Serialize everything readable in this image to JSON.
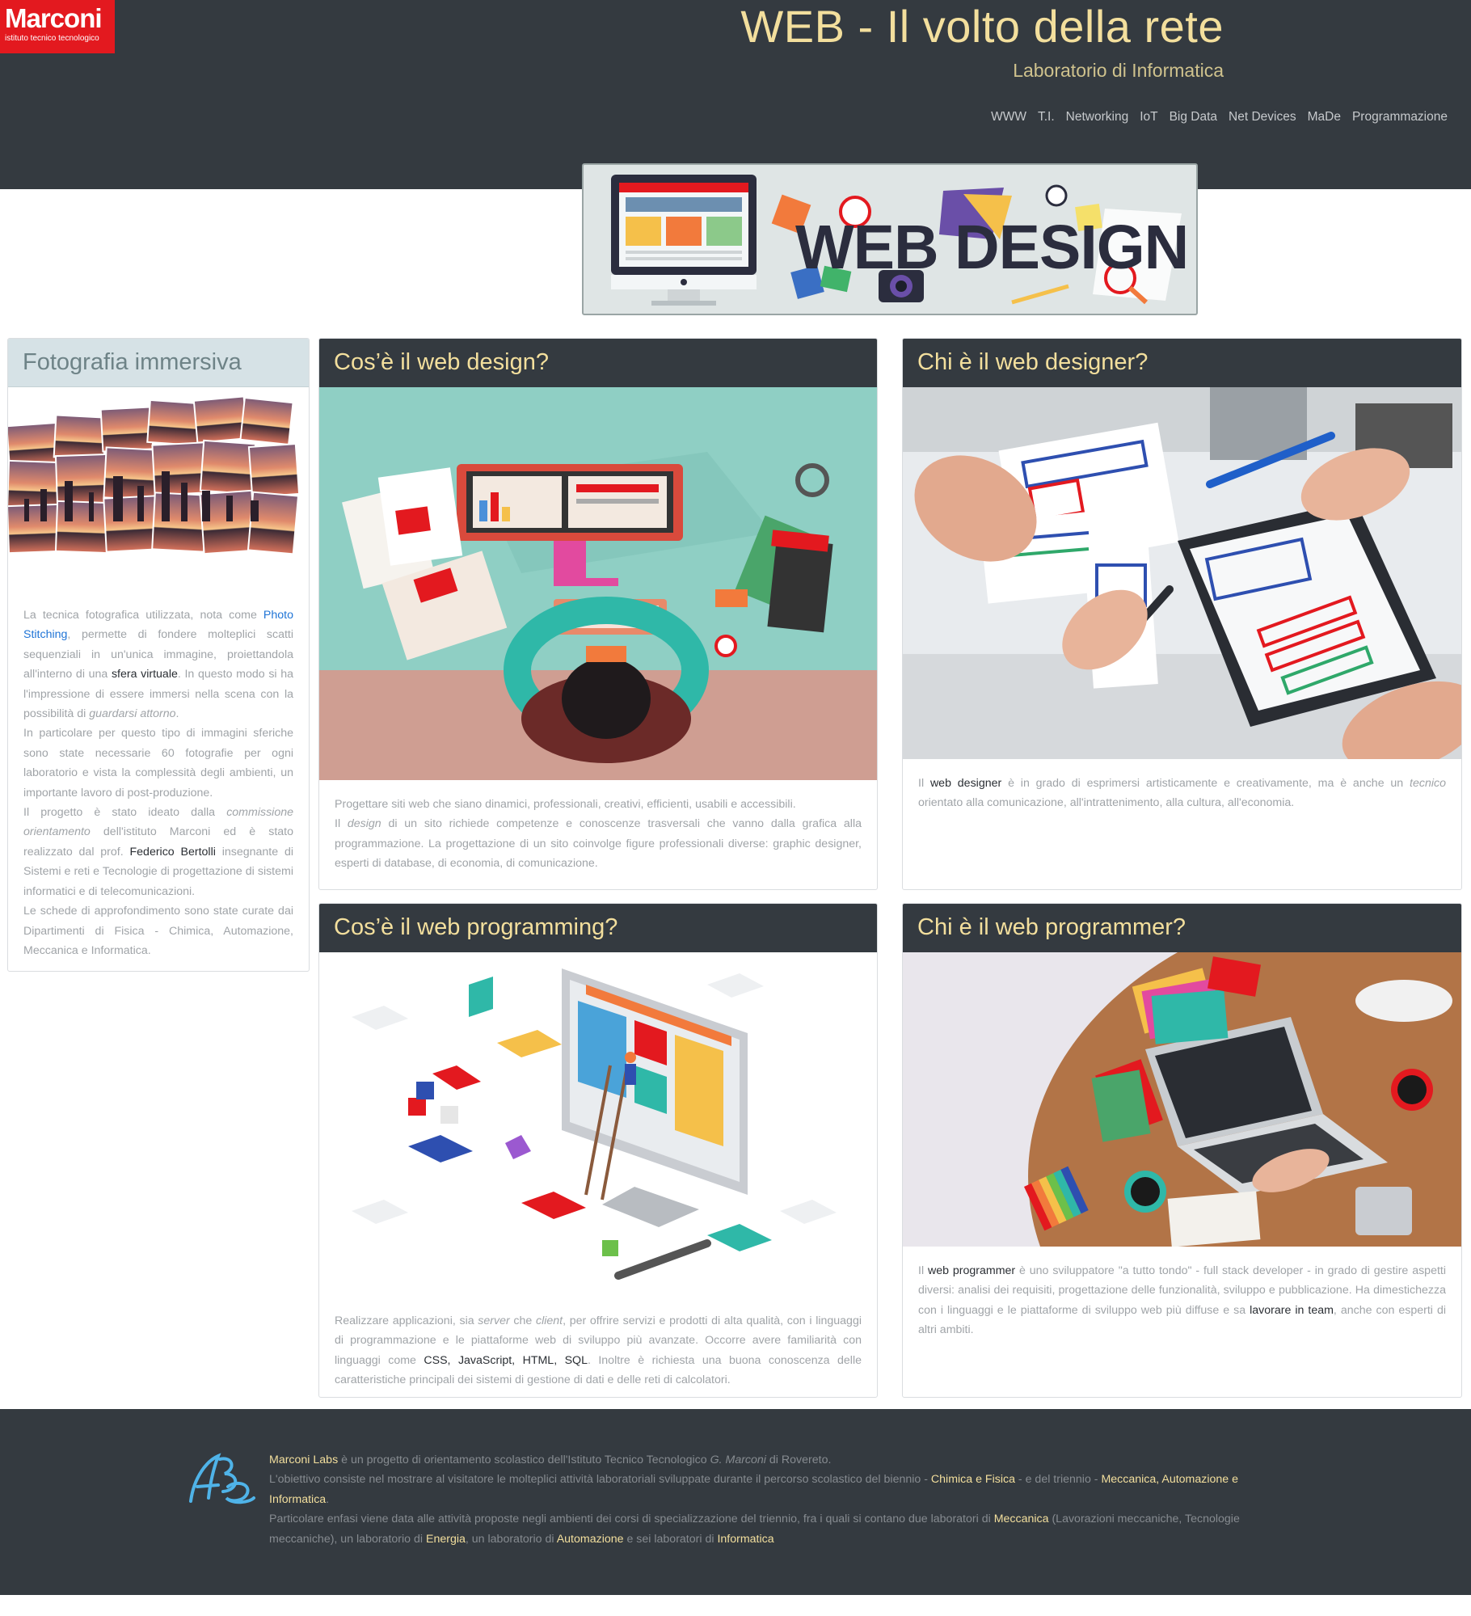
{
  "header": {
    "logo_name": "Marconi",
    "logo_subtitle": "istituto tecnico tecnologico",
    "title": "WEB - Il volto della rete",
    "subtitle": "Laboratorio di Informatica",
    "nav": [
      "WWW",
      "T.I.",
      "Networking",
      "IoT",
      "Big Data",
      "Net Devices",
      "MaDe",
      "Programmazione"
    ]
  },
  "banner": {
    "text": "WEB DESIGN"
  },
  "photo_card": {
    "title": "Fotografia immersiva",
    "p1": [
      "La tecnica fotografica utilizzata, nota come ",
      "Photo Stitching",
      ", permette di fondere molteplici scatti sequenziali in un'unica immagine, proiettandola all'interno di una ",
      "sfera virtuale",
      ". In questo modo si ha l'impressione di essere immersi nella scena con la possibilità di ",
      "guardarsi attorno",
      "."
    ],
    "p2": "In particolare per questo tipo di immagini sferiche sono state necessarie 60 fotografie per ogni laboratorio e vista la complessità degli ambienti, un importante lavoro di post-produzione.",
    "p3": [
      "Il progetto è stato ideato dalla ",
      "commissione orientamento",
      " dell'istituto Marconi ed è stato realizzato dal prof. ",
      "Federico Bertolli",
      " insegnante di Sistemi e reti e Tecnologie di progettazione di sistemi informatici e di telecomunicazioni."
    ],
    "p4": "Le schede di approfondimento sono state curate dai Dipartimenti di Fisica - Chimica, Automazione, Meccanica e Informatica."
  },
  "card_web_design": {
    "title": "Cos’è il web design?",
    "p1": "Progettare siti web che siano dinamici, professionali, creativi, efficienti, usabili e accessibili.",
    "p2": [
      "Il ",
      "design",
      " di un sito richiede competenze e conoscenze trasversali che vanno dalla grafica alla programmazione. La progettazione di un sito coinvolge figure professionali diverse: graphic designer, esperti di database, di economia, di comunicazione."
    ]
  },
  "card_web_designer": {
    "title": "Chi è il web designer?",
    "p1": [
      "Il ",
      "web designer",
      " è in grado di esprimersi artisticamente e creativamente, ma è anche un ",
      "tecnico",
      " orientato alla comunicazione, all'intrattenimento, alla cultura, all'economia."
    ]
  },
  "card_web_programming": {
    "title": "Cos’è il web programming?",
    "p1": [
      "Realizzare applicazioni, sia ",
      "server",
      " che ",
      "client",
      ", per offrire servizi e prodotti di alta qualità, con i linguaggi di programmazione e le piattaforme web di sviluppo più avanzate. Occorre avere familiarità con linguaggi come ",
      "CSS, JavaScript, HTML, SQL",
      ". Inoltre è richiesta una buona conoscenza delle caratteristiche principali dei sistemi di gestione di dati e delle reti di calcolatori."
    ]
  },
  "card_web_programmer": {
    "title": "Chi è il web programmer?",
    "p1": [
      "Il ",
      "web programmer",
      " è uno sviluppatore \"a tutto tondo\" - full stack developer - in grado di gestire aspetti diversi: analisi dei requisiti, progettazione delle funzionalità, sviluppo e pubblicazione. Ha dimestichezza con i linguaggi e le piattaforme di sviluppo web più diffuse e sa ",
      "lavorare in team",
      ", anche con esperti di altri ambiti."
    ]
  },
  "footer": {
    "l1": [
      "Marconi Labs",
      " è un progetto di orientamento scolastico dell'Istituto Tecnico Tecnologico ",
      "G. Marconi",
      " di Rovereto."
    ],
    "l2": [
      "L'obiettivo consiste nel mostrare al visitatore le molteplici attività laboratoriali sviluppate durante il percorso scolastico del biennio - ",
      "Chimica e Fisica",
      " - e del triennio - ",
      "Meccanica, Automazione e Informatica",
      "."
    ],
    "l3": [
      "Particolare enfasi viene data alle attività proposte negli ambienti dei corsi di specializzazione del triennio, fra i quali si contano due laboratori di ",
      "Meccanica",
      " (Lavorazioni meccaniche, Tecnologie meccaniche), un laboratorio di ",
      "Energia",
      ", un laboratorio di ",
      "Automazione",
      " e sei laboratori di ",
      "Informatica"
    ]
  },
  "colors": {
    "header_bg": "#343a40",
    "title": "#f3df9d",
    "logo_red": "#e3191f",
    "link_blue": "#1f74d6"
  }
}
